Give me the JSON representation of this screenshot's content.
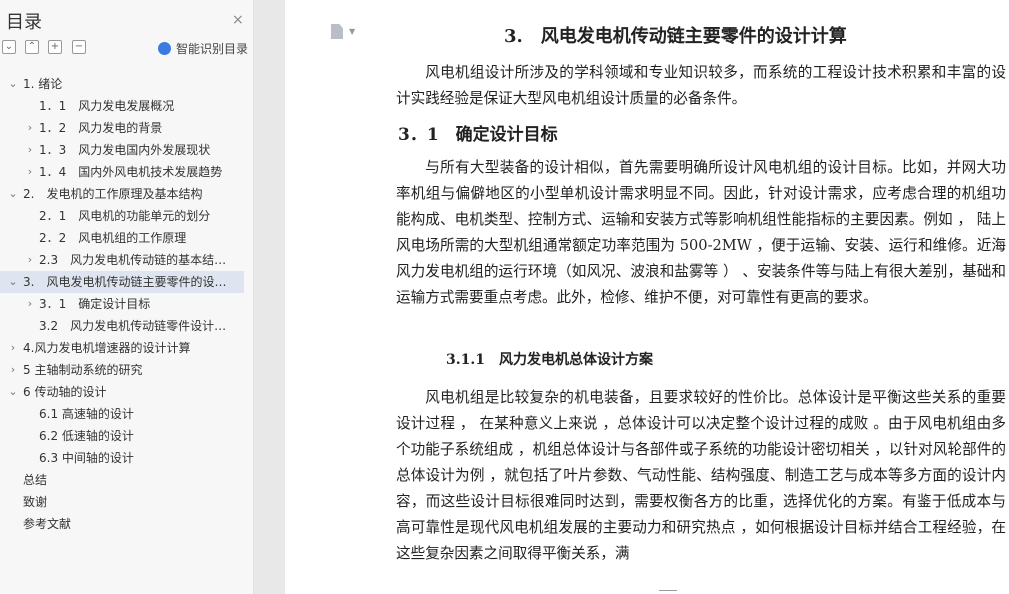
{
  "sidebar": {
    "title": "目录",
    "close_symbol": "×",
    "smart_toc_label": "智能识别目录",
    "tool_icons": [
      "collapse-all-icon",
      "expand-up-icon",
      "add-icon",
      "remove-icon"
    ],
    "items": [
      {
        "label": "1. 绪论",
        "level": 0,
        "arrow": "down"
      },
      {
        "label": "1．1　风力发电发展概况",
        "level": 1,
        "arrow": ""
      },
      {
        "label": "1．2　风力发电的背景",
        "level": 1,
        "arrow": "right"
      },
      {
        "label": "1．3　风力发电国内外发展现状",
        "level": 1,
        "arrow": "right"
      },
      {
        "label": "1．4　国内外风电机技术发展趋势",
        "level": 1,
        "arrow": "right"
      },
      {
        "label": "2.　发电机的工作原理及基本结构",
        "level": 0,
        "arrow": "down"
      },
      {
        "label": "2．1　风电机的功能单元的划分",
        "level": 1,
        "arrow": ""
      },
      {
        "label": "2．2　风电机组的工作原理",
        "level": 1,
        "arrow": ""
      },
      {
        "label": "2.3　风力发电机传动链的基本结构...",
        "level": 1,
        "arrow": "right"
      },
      {
        "label": "3.　风电发电机传动链主要零件的设计...",
        "level": 0,
        "arrow": "down",
        "active": true
      },
      {
        "label": "3．1　确定设计目标",
        "level": 1,
        "arrow": "right"
      },
      {
        "label": "3.2　风力发电机传动链零件设计方...",
        "level": 1,
        "arrow": ""
      },
      {
        "label": "4.风力发电机增速器的设计计算",
        "level": 0,
        "arrow": "right"
      },
      {
        "label": "5 主轴制动系统的研究",
        "level": 0,
        "arrow": "right"
      },
      {
        "label": "6 传动轴的设计",
        "level": 0,
        "arrow": "down"
      },
      {
        "label": "6.1 高速轴的设计",
        "level": 1,
        "arrow": ""
      },
      {
        "label": "6.2 低速轴的设计",
        "level": 1,
        "arrow": ""
      },
      {
        "label": "6.3 中间轴的设计",
        "level": 1,
        "arrow": ""
      },
      {
        "label": "总结",
        "level": 0,
        "arrow": ""
      },
      {
        "label": "致谢",
        "level": 0,
        "arrow": ""
      },
      {
        "label": "参考文献",
        "level": 0,
        "arrow": ""
      }
    ]
  },
  "document": {
    "heading1": "3.　风电发电机传动链主要零件的设计计算",
    "para1": "风电机组设计所涉及的学科领域和专业知识较多，而系统的工程设计技术积累和丰富的设计实践经验是保证大型风电机组设计质量的必备条件。",
    "heading2": "3．1　确定设计目标",
    "para2": "与所有大型装备的设计相似，首先需要明确所设计风电机组的设计目标。比如，并网大功率机组与偏僻地区的小型单机设计需求明显不同。因此，针对设计需求，应考虑合理的机组功能构成、电机类型、控制方式、运输和安装方式等影响机组性能指标的主要因素。例如 ，  陆上风电场所需的大型机组通常额定功率范围为 500-2MW ，便于运输、安装、运行和维修。近海风力发电机组的运行环境（如风况、波浪和盐雾等 ） 、安装条件等与陆上有很大差别，基础和运输方式需要重点考虑。此外，检修、维护不便，对可靠性有更高的要求。",
    "heading3": "3.1.1　风力发电机总体设计方案",
    "para3": "风电机组是比较复杂的机电装备，且要求较好的性价比。总体设计是平衡这些关系的重要设计过程 ，  在某种意义上来说 ，总体设计可以决定整个设计过程的成败 。由于风电机组由多个功能子系统组成 ，机组总体设计与各部件或子系统的功能设计密切相关 ，以针对风轮部件的总体设计为例 ，就包括了叶片参数、气动性能、结构强度、制造工艺与成本等多方面的设计内容，而这些设计目标很难同时达到，需要权衡各方的比重，选择优化的方案。有鉴于低成本与高可靠性是现代风电机组发展的主要动力和研究热点 ，如何根据设计目标并结合工程经验，在这些复杂因素之间取得平衡关系，满"
  },
  "colors": {
    "sidebar_bg": "#f7f7f7",
    "active_item_bg": "#dfe5f0",
    "page_bg": "#ffffff",
    "smart_icon": "#3a7be0"
  }
}
